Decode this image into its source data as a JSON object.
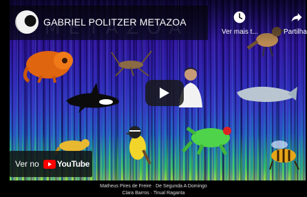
{
  "video": {
    "title": "GABRIEL POLITZER METAZOA",
    "watermark": "METAZOA"
  },
  "actions": {
    "watch_later_label": "Ver mais t...",
    "share_label": "Partilhar"
  },
  "watch_on": {
    "label": "Ver no",
    "brand": "YouTube"
  },
  "credits": {
    "line1": "Matheus Pires de Freire · De Segunda A Domingo",
    "line2": "Clara Barros · Tirual Raganta"
  },
  "icons": {
    "watch_later": "clock-icon",
    "share": "share-arrow-icon",
    "play": "play-icon",
    "youtube": "youtube-logo-icon"
  },
  "colors": {
    "youtube_red": "#ff0000",
    "overlay_dark": "#121212"
  }
}
